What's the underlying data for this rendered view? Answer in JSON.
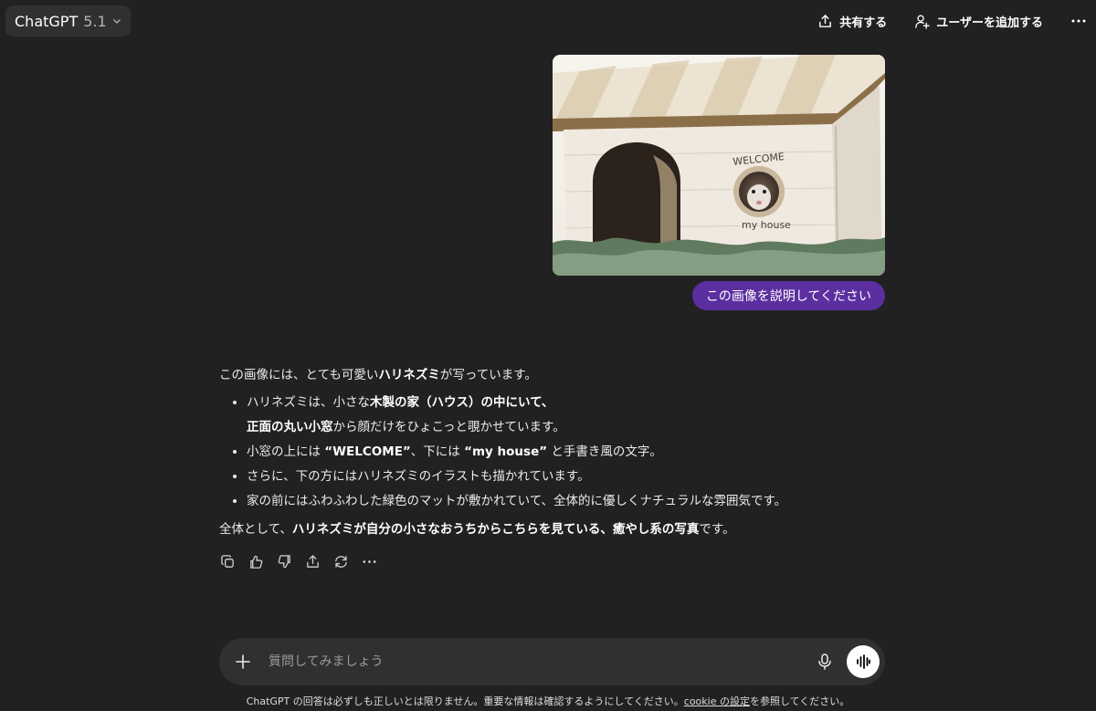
{
  "header": {
    "model_name": "ChatGPT",
    "model_version": "5.1",
    "share_label": "共有する",
    "add_user_label": "ユーザーを追加する"
  },
  "conversation": {
    "user_image": {
      "sign_top": "WELCOME",
      "sign_bottom": "my house"
    },
    "user_message": "この画像を説明してください",
    "response": {
      "intro_a": "この画像には、とても可愛い",
      "intro_b": "ハリネズミ",
      "intro_c": "が写っています。",
      "bullet1_a": "ハリネズミは、小さな",
      "bullet1_b": "木製の家（ハウス）の中にいて、",
      "bullet1_c": "正面の丸い小窓",
      "bullet1_d": "から顔だけをひょこっと覗かせています。",
      "bullet2_a": "小窓の上には ",
      "bullet2_b": "“WELCOME”",
      "bullet2_c": "、下には ",
      "bullet2_d": "“my house”",
      "bullet2_e": " と手書き風の文字。",
      "bullet3": "さらに、下の方にはハリネズミのイラストも描かれています。",
      "bullet4": "家の前にはふわふわした緑色のマットが敷かれていて、全体的に優しくナチュラルな雰囲気です。",
      "closing_a": "全体として、",
      "closing_b": "ハリネズミが自分の小さなおうちからこちらを見ている、癒やし系の写真",
      "closing_c": "です。"
    }
  },
  "composer": {
    "placeholder": "質問してみましょう"
  },
  "footer": {
    "text_a": "ChatGPT の回答は必ずしも正しいとは限りません。重要な情報は確認するようにしてください。",
    "link": "cookie の設定",
    "text_b": "を参照してください。"
  },
  "icons": {
    "model_menu": "chevron-down-icon",
    "share": "share-icon",
    "add_user": "add-user-icon",
    "more": "more-icon",
    "copy": "copy-icon",
    "thumbs_up": "thumbs-up-icon",
    "thumbs_down": "thumbs-down-icon",
    "share_response": "share-icon",
    "regenerate": "regenerate-icon",
    "plus": "plus-icon",
    "mic": "mic-icon",
    "voice": "voice-mode-icon"
  },
  "colors": {
    "background": "#212121",
    "user_bubble": "#5b2fa0",
    "composer": "#303030"
  }
}
